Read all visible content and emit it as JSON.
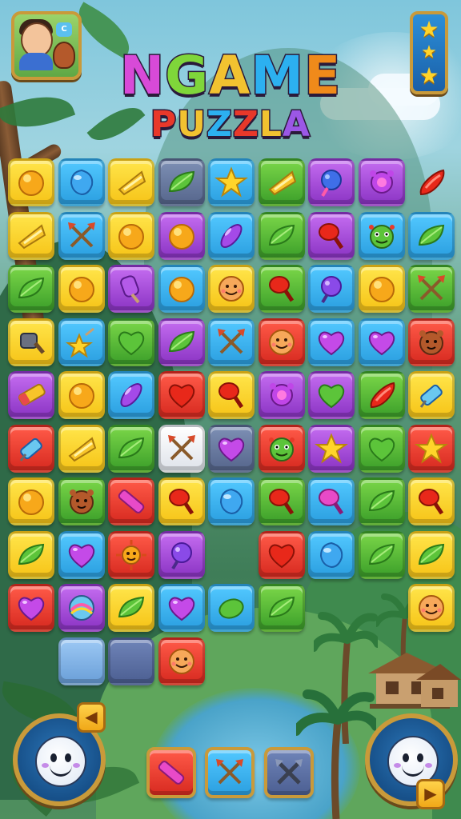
{
  "header": {
    "title_line1": "NGAME",
    "title_line2": "PUZZLA",
    "avatar_badge": "C",
    "stars": [
      "★",
      "★",
      "★"
    ]
  },
  "colors": {
    "title1": [
      "#d84ad8",
      "#7fd63a",
      "#f2c230",
      "#2cb0f0",
      "#f08a1a"
    ],
    "title2": [
      "#e8382a",
      "#f2c230",
      "#2cb0f0",
      "#e8382a",
      "#f2c230",
      "#9b57e6"
    ]
  },
  "board": {
    "rows": [
      [
        [
          "yellow",
          "orange-candy"
        ],
        [
          "blue",
          "blue-gem"
        ],
        [
          "yellow",
          "cheese-wedge"
        ],
        [
          "slate",
          "green-leaf"
        ],
        [
          "blue",
          "yellow-star"
        ],
        [
          "green",
          "cheese-wedge"
        ],
        [
          "purple",
          "blue-blob"
        ],
        [
          "purple",
          "purple-flower"
        ],
        [
          "none",
          "red-pepper"
        ]
      ],
      [
        [
          "yellow",
          "cheese-wedge"
        ],
        [
          "blue",
          "crossed-arrows"
        ],
        [
          "yellow",
          "orange-candy"
        ],
        [
          "purple",
          "orange-candy"
        ],
        [
          "blue",
          "purple-oval"
        ],
        [
          "green",
          "green-leaf"
        ],
        [
          "purple",
          "red-drumstick"
        ],
        [
          "blue",
          "green-monster"
        ],
        [
          "blue",
          "green-leaf"
        ]
      ],
      [
        [
          "green",
          "green-leaf"
        ],
        [
          "yellow",
          "orange-candy"
        ],
        [
          "purple",
          "popsicle"
        ],
        [
          "blue",
          "orange-candy"
        ],
        [
          "yellow",
          "smiley-face"
        ],
        [
          "green",
          "red-drumstick"
        ],
        [
          "blue",
          "purple-blob"
        ],
        [
          "yellow",
          "orange-candy"
        ],
        [
          "green",
          "crossed-arrows"
        ]
      ],
      [
        [
          "yellow",
          "stone-axe"
        ],
        [
          "blue",
          "yellow-star-wand"
        ],
        [
          "green",
          "green-heart"
        ],
        [
          "purple",
          "green-leaf"
        ],
        [
          "blue",
          "crossed-arrows"
        ],
        [
          "red",
          "smiley-face"
        ],
        [
          "blue",
          "purple-heart"
        ],
        [
          "blue",
          "purple-heart"
        ],
        [
          "red",
          "brown-bear"
        ]
      ],
      [
        [
          "purple",
          "yellow-bar"
        ],
        [
          "yellow",
          "orange-candy"
        ],
        [
          "blue",
          "purple-oval"
        ],
        [
          "red",
          "red-heart"
        ],
        [
          "yellow",
          "red-drumstick"
        ],
        [
          "purple",
          "purple-flower"
        ],
        [
          "purple",
          "green-heart"
        ],
        [
          "green",
          "red-pepper"
        ],
        [
          "yellow",
          "blue-wand"
        ]
      ],
      [
        [
          "red",
          "blue-wand"
        ],
        [
          "yellow",
          "cheese-wedge"
        ],
        [
          "green",
          "green-leaf"
        ],
        [
          "white",
          "crossed-arrows"
        ],
        [
          "slate",
          "purple-heart"
        ],
        [
          "red",
          "green-monster"
        ],
        [
          "purple",
          "yellow-star"
        ],
        [
          "green",
          "green-heart"
        ],
        [
          "red",
          "yellow-star"
        ]
      ],
      [
        [
          "yellow",
          "orange-candy"
        ],
        [
          "green",
          "brown-bear"
        ],
        [
          "red",
          "pink-bar"
        ],
        [
          "yellow",
          "red-drumstick"
        ],
        [
          "blue",
          "blue-gem"
        ],
        [
          "green",
          "red-drumstick"
        ],
        [
          "blue",
          "pink-drumstick"
        ],
        [
          "green",
          "green-leaf"
        ],
        [
          "yellow",
          "red-drumstick"
        ]
      ],
      [
        [
          "yellow",
          "green-leaf"
        ],
        [
          "blue",
          "purple-heart"
        ],
        [
          "red",
          "orange-sun"
        ],
        [
          "purple",
          "purple-blob"
        ],
        [
          "none",
          ""
        ],
        [
          "red",
          "red-heart"
        ],
        [
          "blue",
          "blue-gem"
        ],
        [
          "green",
          "green-leaf"
        ],
        [
          "yellow",
          "green-leaf"
        ]
      ],
      [
        [
          "red",
          "purple-heart"
        ],
        [
          "purple",
          "rainbow-ball"
        ],
        [
          "yellow",
          "green-leaf"
        ],
        [
          "blue",
          "purple-heart"
        ],
        [
          "blue",
          "green-oval"
        ],
        [
          "green",
          "green-leaf"
        ],
        [
          "none",
          ""
        ],
        [
          "none",
          ""
        ],
        [
          "yellow",
          "smiley-face"
        ]
      ],
      [
        [
          "none",
          ""
        ],
        [
          "lightblue",
          ""
        ],
        [
          "dslate",
          ""
        ],
        [
          "red",
          "smiley-face"
        ],
        [
          "none",
          ""
        ],
        [
          "none",
          ""
        ],
        [
          "none",
          ""
        ],
        [
          "none",
          ""
        ],
        [
          "none",
          ""
        ]
      ]
    ]
  },
  "bottom": {
    "left_arrow": "◀",
    "right_arrow": "▶",
    "tiles": [
      [
        "red",
        "pink-bar"
      ],
      [
        "blue",
        "crossed-arrows"
      ],
      [
        "dslate",
        "crossed-arrows-gray"
      ]
    ]
  }
}
